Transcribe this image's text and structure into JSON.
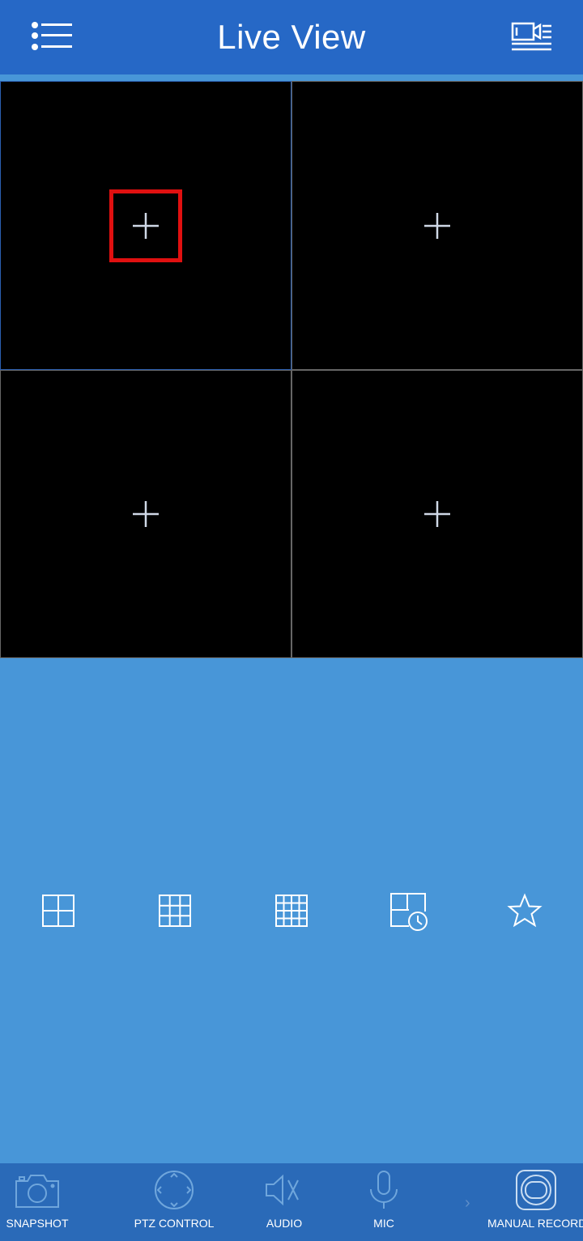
{
  "header": {
    "title": "Live View",
    "menu_icon": "list-menu-icon",
    "record_icon": "video-list-icon"
  },
  "colors": {
    "header_bg": "#2668c6",
    "body_bg": "#4896d8",
    "bottom_bar_bg": "#2a6ab8",
    "highlight": "#e01010",
    "active_cell_border": "#2b5fb0"
  },
  "live_grid": {
    "layout": "2x2",
    "cells": [
      {
        "state": "empty",
        "action_icon": "add-icon",
        "selected": true
      },
      {
        "state": "empty",
        "action_icon": "add-icon",
        "selected": false
      },
      {
        "state": "empty",
        "action_icon": "add-icon",
        "selected": false
      },
      {
        "state": "empty",
        "action_icon": "add-icon",
        "selected": false
      }
    ]
  },
  "layout_options": [
    {
      "icon": "grid-4-icon"
    },
    {
      "icon": "grid-9-icon"
    },
    {
      "icon": "grid-16-icon"
    },
    {
      "icon": "schedule-layout-icon"
    },
    {
      "icon": "favorite-star-icon"
    }
  ],
  "toolbar": {
    "items": [
      {
        "label": "SNAPSHOT",
        "icon": "camera-icon"
      },
      {
        "label": "PTZ CONTROL",
        "icon": "ptz-dpad-icon"
      },
      {
        "label": "AUDIO",
        "icon": "speaker-muted-icon"
      },
      {
        "label": "MIC",
        "icon": "microphone-icon"
      },
      {
        "label": "MANUAL RECORD",
        "icon": "record-icon"
      }
    ],
    "more_icon": "chevron-right-icon"
  }
}
